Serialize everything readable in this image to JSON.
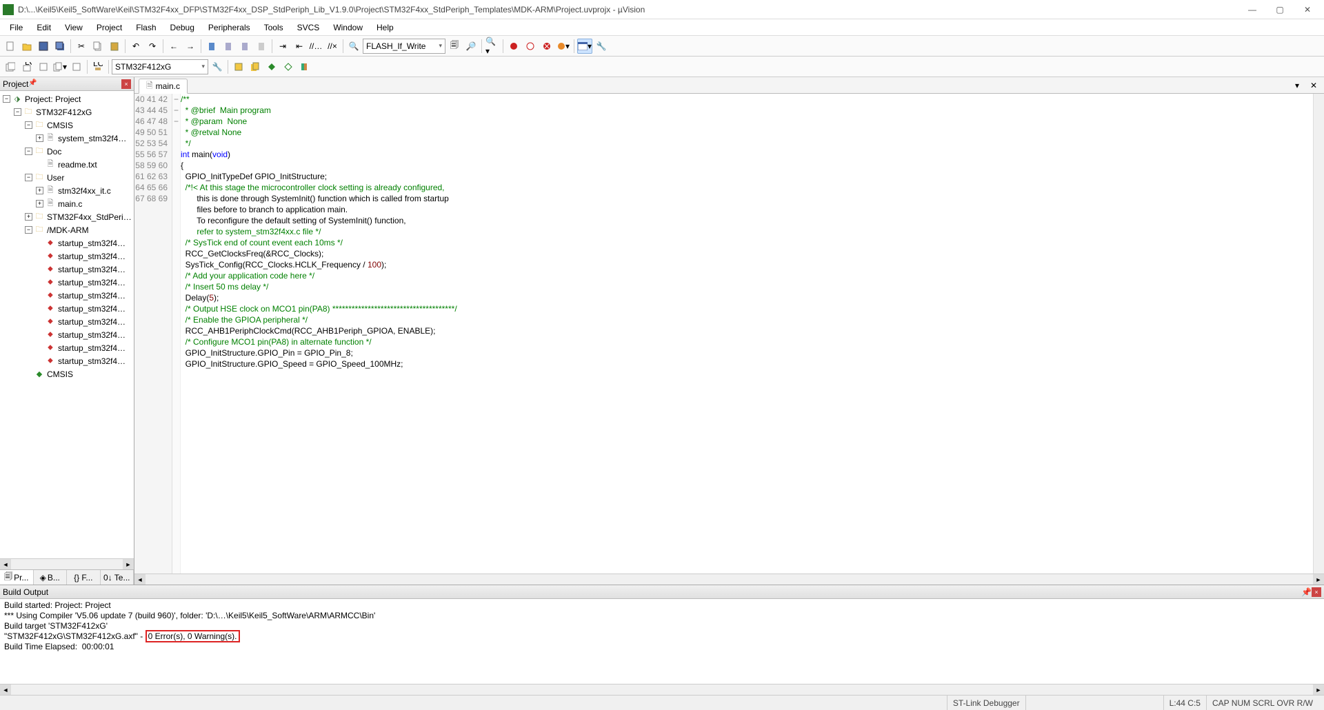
{
  "window": {
    "title": "D:\\...\\Keil5\\Keil5_SoftWare\\Keil\\STM32F4xx_DFP\\STM32F4xx_DSP_StdPeriph_Lib_V1.9.0\\Project\\STM32F4xx_StdPeriph_Templates\\MDK-ARM\\Project.uvprojx - µVision"
  },
  "menu": [
    "File",
    "Edit",
    "View",
    "Project",
    "Flash",
    "Debug",
    "Peripherals",
    "Tools",
    "SVCS",
    "Window",
    "Help"
  ],
  "toolbar1": {
    "flash_target": "FLASH_If_Write"
  },
  "toolbar2": {
    "target": "STM32F412xG"
  },
  "project_panel": {
    "title": "Project",
    "root": "Project: Project",
    "target": "STM32F412xG",
    "groups": {
      "cmsis": "CMSIS",
      "cmsis_file": "system_stm32f4…",
      "doc": "Doc",
      "doc_file": "readme.txt",
      "user": "User",
      "user_f1": "stm32f4xx_it.c",
      "user_f2": "main.c",
      "stdperiph": "STM32F4xx_StdPeri…",
      "mdk": "/MDK-ARM",
      "startup": "startup_stm32f4…",
      "cmsis_cmp": "CMSIS"
    }
  },
  "sidebar_tabs": {
    "a": "Pr...",
    "b": "B...",
    "c": "{} F...",
    "d": "0↓ Te..."
  },
  "editor": {
    "tab": "main.c",
    "first_line": 40,
    "lines": [
      "/**",
      "  * @brief  Main program",
      "  * @param  None",
      "  * @retval None",
      "  */",
      "int main(void)",
      "{",
      "  GPIO_InitTypeDef GPIO_InitStructure;",
      "",
      "  /*!< At this stage the microcontroller clock setting is already configured,",
      "       this is done through SystemInit() function which is called from startup",
      "       files before to branch to application main.",
      "       To reconfigure the default setting of SystemInit() function,",
      "       refer to system_stm32f4xx.c file */",
      "",
      "  /* SysTick end of count event each 10ms */",
      "  RCC_GetClocksFreq(&RCC_Clocks);",
      "  SysTick_Config(RCC_Clocks.HCLK_Frequency / 100);",
      "",
      "  /* Add your application code here */",
      "  /* Insert 50 ms delay */",
      "  Delay(5);",
      "",
      "  /* Output HSE clock on MCO1 pin(PA8) **************************************/",
      "  /* Enable the GPIOA peripheral */",
      "  RCC_AHB1PeriphClockCmd(RCC_AHB1Periph_GPIOA, ENABLE);",
      "",
      "  /* Configure MCO1 pin(PA8) in alternate function */",
      "  GPIO_InitStructure.GPIO_Pin = GPIO_Pin_8;",
      "  GPIO_InitStructure.GPIO_Speed = GPIO_Speed_100MHz;"
    ]
  },
  "build": {
    "title": "Build Output",
    "l1": "Build started: Project: Project",
    "l2": "*** Using Compiler 'V5.06 update 7 (build 960)', folder: 'D:\\…\\Keil5\\Keil5_SoftWare\\ARM\\ARMCC\\Bin'",
    "l3": "Build target 'STM32F412xG'",
    "l4a": "\"STM32F412xG\\STM32F412xG.axf\" - ",
    "l4b": "0 Error(s), 0 Warning(s).",
    "l5": "Build Time Elapsed:  00:00:01"
  },
  "status": {
    "debugger": "ST-Link Debugger",
    "cursor": "L:44 C:5",
    "caps": "CAP  NUM  SCRL  OVR  R/W"
  }
}
